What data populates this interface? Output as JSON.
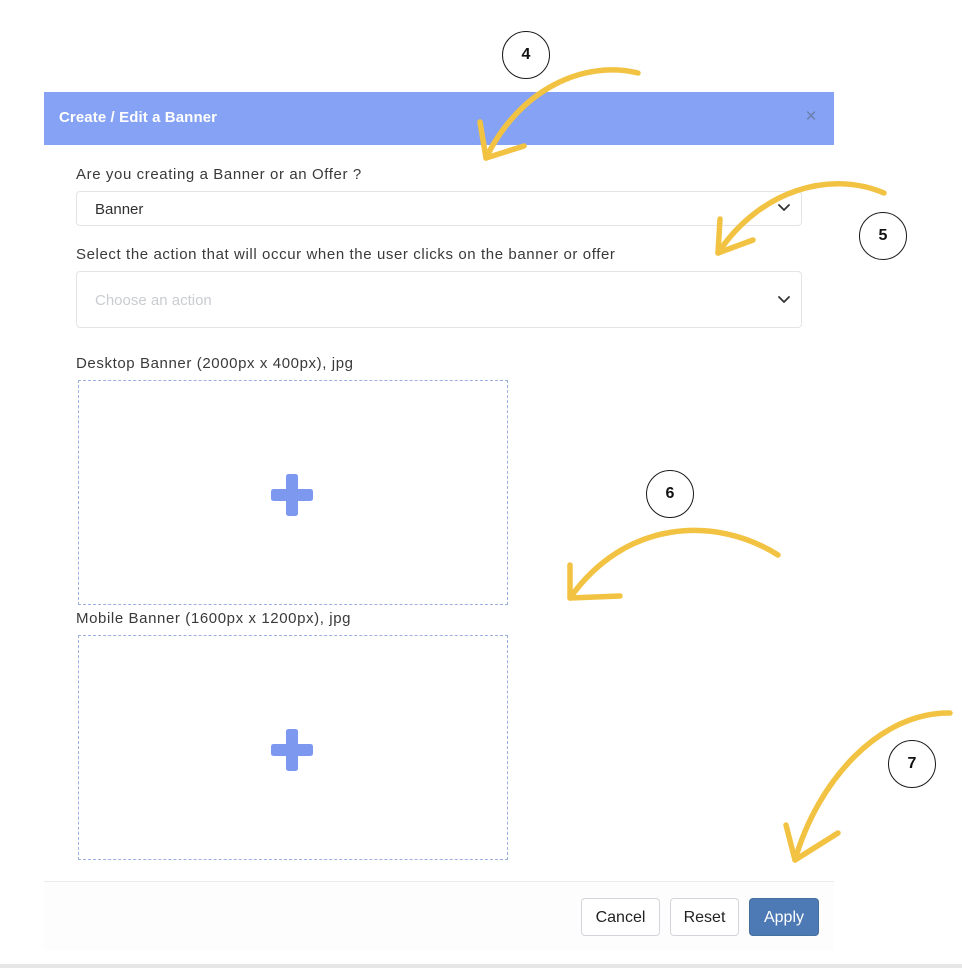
{
  "dialog": {
    "title": "Create / Edit a Banner",
    "close_symbol": "×"
  },
  "form": {
    "type_question": "Are you creating a Banner or an Offer ?",
    "type_value": "Banner",
    "action_question": "Select the action that will occur when the user clicks on the banner or offer",
    "action_placeholder": "Choose an action",
    "desktop_label": "Desktop Banner (2000px x 400px), jpg",
    "mobile_label": "Mobile Banner (1600px x 1200px), jpg"
  },
  "footer": {
    "cancel_label": "Cancel",
    "reset_label": "Reset",
    "apply_label": "Apply"
  },
  "annotations": {
    "steps": [
      "4",
      "5",
      "6",
      "7"
    ]
  },
  "icons": {
    "close": "close-icon",
    "dropdown": "chevron-down-icon",
    "upload": "plus-icon",
    "callout": "curved-arrow"
  },
  "colors": {
    "header": "#85a2f4",
    "accent_plus": "#7d99ef",
    "primary_button": "#4d79b4",
    "arrow": "#f2c242"
  }
}
